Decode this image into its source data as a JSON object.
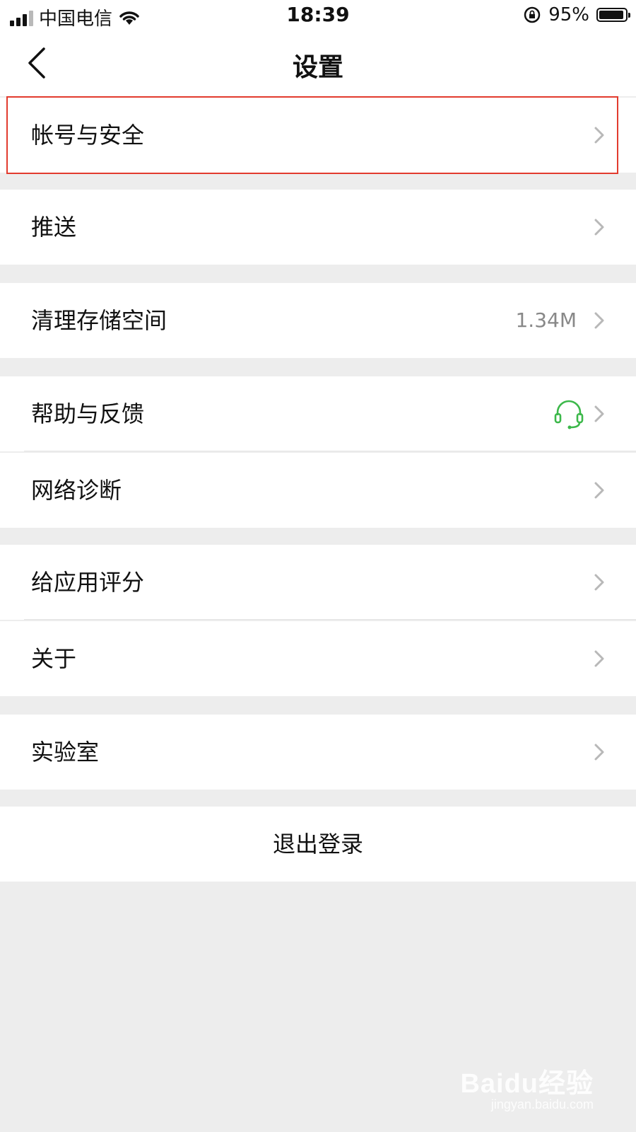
{
  "status_bar": {
    "carrier": "中国电信",
    "time": "18:39",
    "battery": "95%",
    "battery_level": 0.95
  },
  "nav": {
    "title": "设置"
  },
  "rows": [
    {
      "label": "帐号与安全",
      "highlighted": true
    },
    {
      "label": "推送"
    },
    {
      "label": "清理存储空间",
      "value": "1.34M"
    },
    {
      "label": "帮助与反馈",
      "icon": "headset-icon"
    },
    {
      "label": "网络诊断"
    },
    {
      "label": "给应用评分"
    },
    {
      "label": "关于"
    },
    {
      "label": "实验室"
    }
  ],
  "logout_label": "退出登录",
  "watermark": {
    "main": "Baidu经验",
    "sub": "jingyan.baidu.com"
  },
  "colors": {
    "background": "#ededed",
    "highlight": "#e23b2e",
    "headset": "#3cb84a"
  }
}
